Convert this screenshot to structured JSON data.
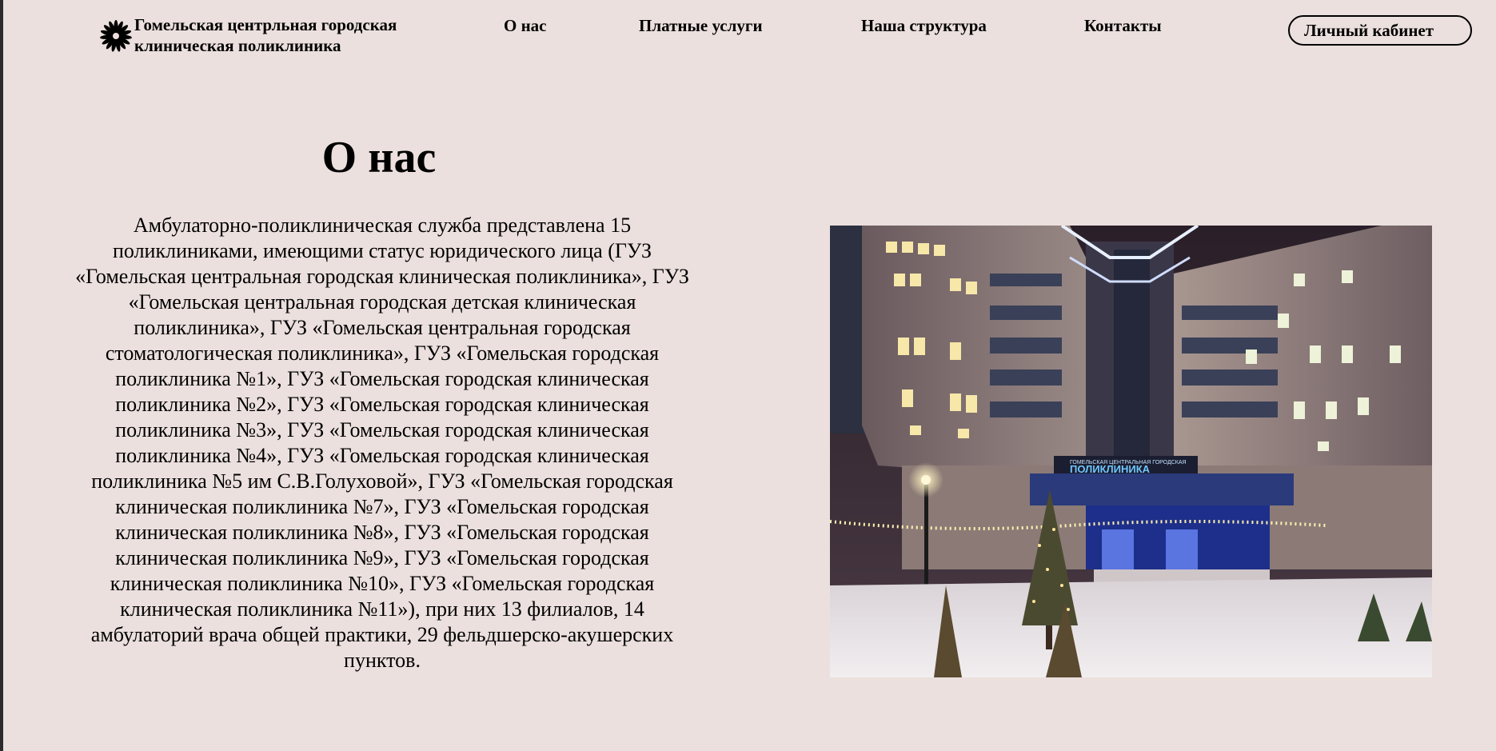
{
  "header": {
    "brand_name": "Гомельская центрльная городская клиническая поликлиника",
    "nav": [
      {
        "label": "О нас"
      },
      {
        "label": "Платные услуги"
      },
      {
        "label": "Наша структура"
      },
      {
        "label": "Контакты"
      }
    ],
    "cabinet_label": "Личный кабинет"
  },
  "main": {
    "title": "О нас",
    "text": "Амбулаторно-поликлиническая служба представлена 15 поликлиниками, имеющими статус юридического лица (ГУЗ «Гомельская центральная городская клиническая поликлиника», ГУЗ «Гомельская центральная городская детская клиническая поликлиника», ГУЗ «Гомельская центральная городская стоматологическая поликлиника», ГУЗ «Гомельская городская поликлиника №1», ГУЗ «Гомельская городская клиническая поликлиника №2», ГУЗ «Гомельская городская клиническая поликлиника №3», ГУЗ «Гомельская городская клиническая поликлиника №4», ГУЗ «Гомельская городская клиническая поликлиника №5 им С.В.Голуховой», ГУЗ «Гомельская городская клиническая поликлиника №7», ГУЗ «Гомельская городская клиническая поликлиника №8», ГУЗ «Гомельская городская клиническая поликлиника №9», ГУЗ «Гомельская городская клиническая поликлиника №10», ГУЗ «Гомельская городская клиническая поликлиника №11»), при них 13 филиалов, 14 амбулаторий врача общей практики, 29 фельдшерско-акушерских пунктов.",
    "photo": {
      "sign_small": "ГОМЕЛЬСКАЯ ЦЕНТРАЛЬНАЯ ГОРОДСКАЯ",
      "sign_large": "ПОЛИКЛИНИКА"
    }
  },
  "colors": {
    "background": "#ebe0de",
    "text": "#000000"
  },
  "icons": {
    "brand": "flower-icon"
  }
}
